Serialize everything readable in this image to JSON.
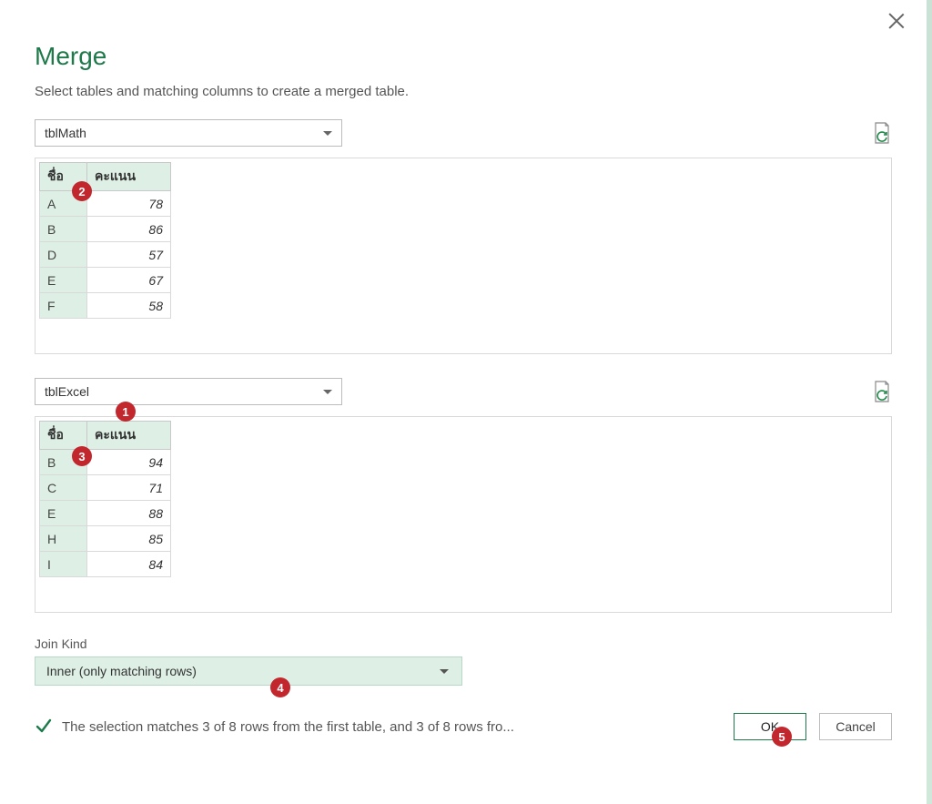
{
  "dialog": {
    "title": "Merge",
    "subtitle": "Select tables and matching columns to create a merged table."
  },
  "table1": {
    "dropdown_value": "tblMath",
    "headers": [
      "ชื่อ",
      "คะแนน"
    ],
    "rows": [
      {
        "key": "A",
        "val": "78"
      },
      {
        "key": "B",
        "val": "86"
      },
      {
        "key": "D",
        "val": "57"
      },
      {
        "key": "E",
        "val": "67"
      },
      {
        "key": "F",
        "val": "58"
      }
    ]
  },
  "table2": {
    "dropdown_value": "tblExcel",
    "headers": [
      "ชื่อ",
      "คะแนน"
    ],
    "rows": [
      {
        "key": "B",
        "val": "94"
      },
      {
        "key": "C",
        "val": "71"
      },
      {
        "key": "E",
        "val": "88"
      },
      {
        "key": "H",
        "val": "85"
      },
      {
        "key": "I",
        "val": "84"
      }
    ]
  },
  "join": {
    "label": "Join Kind",
    "value": "Inner (only matching rows)"
  },
  "status_text": "The selection matches 3 of 8 rows from the first table, and 3 of 8 rows fro...",
  "buttons": {
    "ok": "OK",
    "cancel": "Cancel"
  },
  "annotations": [
    "1",
    "2",
    "3",
    "4",
    "5"
  ]
}
